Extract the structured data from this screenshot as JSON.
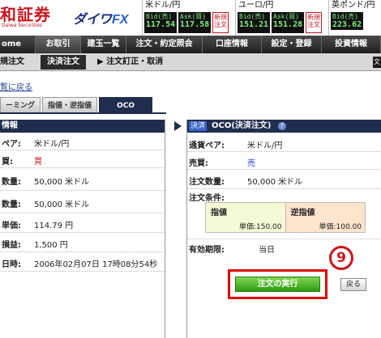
{
  "brand": {
    "logo_text": "和証券",
    "logo_sub": "Daiwa Securities",
    "product_prefix": "ダイワ",
    "product_suffix": "FX"
  },
  "rates": [
    {
      "pair": "米ドル/円",
      "bid_label": "Bid(売)",
      "bid": "117.54",
      "ask_label": "Ask(買)",
      "ask": "117.58",
      "new_label": "新規注文"
    },
    {
      "pair": "ユーロ/円",
      "bid_label": "Bid(売)",
      "bid": "151.21",
      "ask_label": "Ask(買)",
      "ask": "151.28",
      "new_label": "新規注文"
    },
    {
      "pair": "英ポンド/円",
      "bid_label": "Bid(売)",
      "bid": "223.62"
    }
  ],
  "mainnav": [
    "ome",
    "お取引",
    "建玉一覧",
    "注文・約定照会",
    "口座情報",
    "設定・登録",
    "投資情報"
  ],
  "subnav": {
    "item1": "規注文",
    "item2": "決済注文",
    "item3": "▶ 注文訂正・取消",
    "edge": "文"
  },
  "back_link": "覧に戻る",
  "tabs": [
    "ーミング",
    "指値・逆指値",
    "OCO"
  ],
  "left": {
    "header": "情報",
    "rows": [
      {
        "k": "ペア:",
        "v": "米ドル/円"
      },
      {
        "k": "買:",
        "v": "買"
      },
      {
        "k": "数量:",
        "v": "50,000 米ドル"
      },
      {
        "k": "数量:",
        "v": "50,000 米ドル"
      },
      {
        "k": "単価:",
        "v": "114.79 円"
      },
      {
        "k": "損益:",
        "v": "1,500 円"
      },
      {
        "k": "日時:",
        "v": "2006年02月07日 17時08分54秒"
      }
    ]
  },
  "right": {
    "tag": "決済",
    "title": "OCO(決済注文)",
    "help": "?",
    "pair_label": "通貨ペア:",
    "pair_value": "米ドル/円",
    "side_label": "売買:",
    "side_value": "売",
    "qty_label": "注文数量:",
    "qty_value": "50,000 米ドル",
    "cond_label": "注文条件:",
    "limit_label": "指値",
    "limit_value": "単価:150.00",
    "stop_label": "逆指値",
    "stop_value": "単価:100.00",
    "validity_label": "有効期限:",
    "validity_value": "当日"
  },
  "marker": "9",
  "buttons": {
    "execute": "注文の実行",
    "back": "戻る"
  },
  "colors": {
    "brand_red": "#c8161d",
    "nav_dark": "#1f2d4e",
    "execute_green": "#2e9a16",
    "highlight": "#dd0000"
  }
}
